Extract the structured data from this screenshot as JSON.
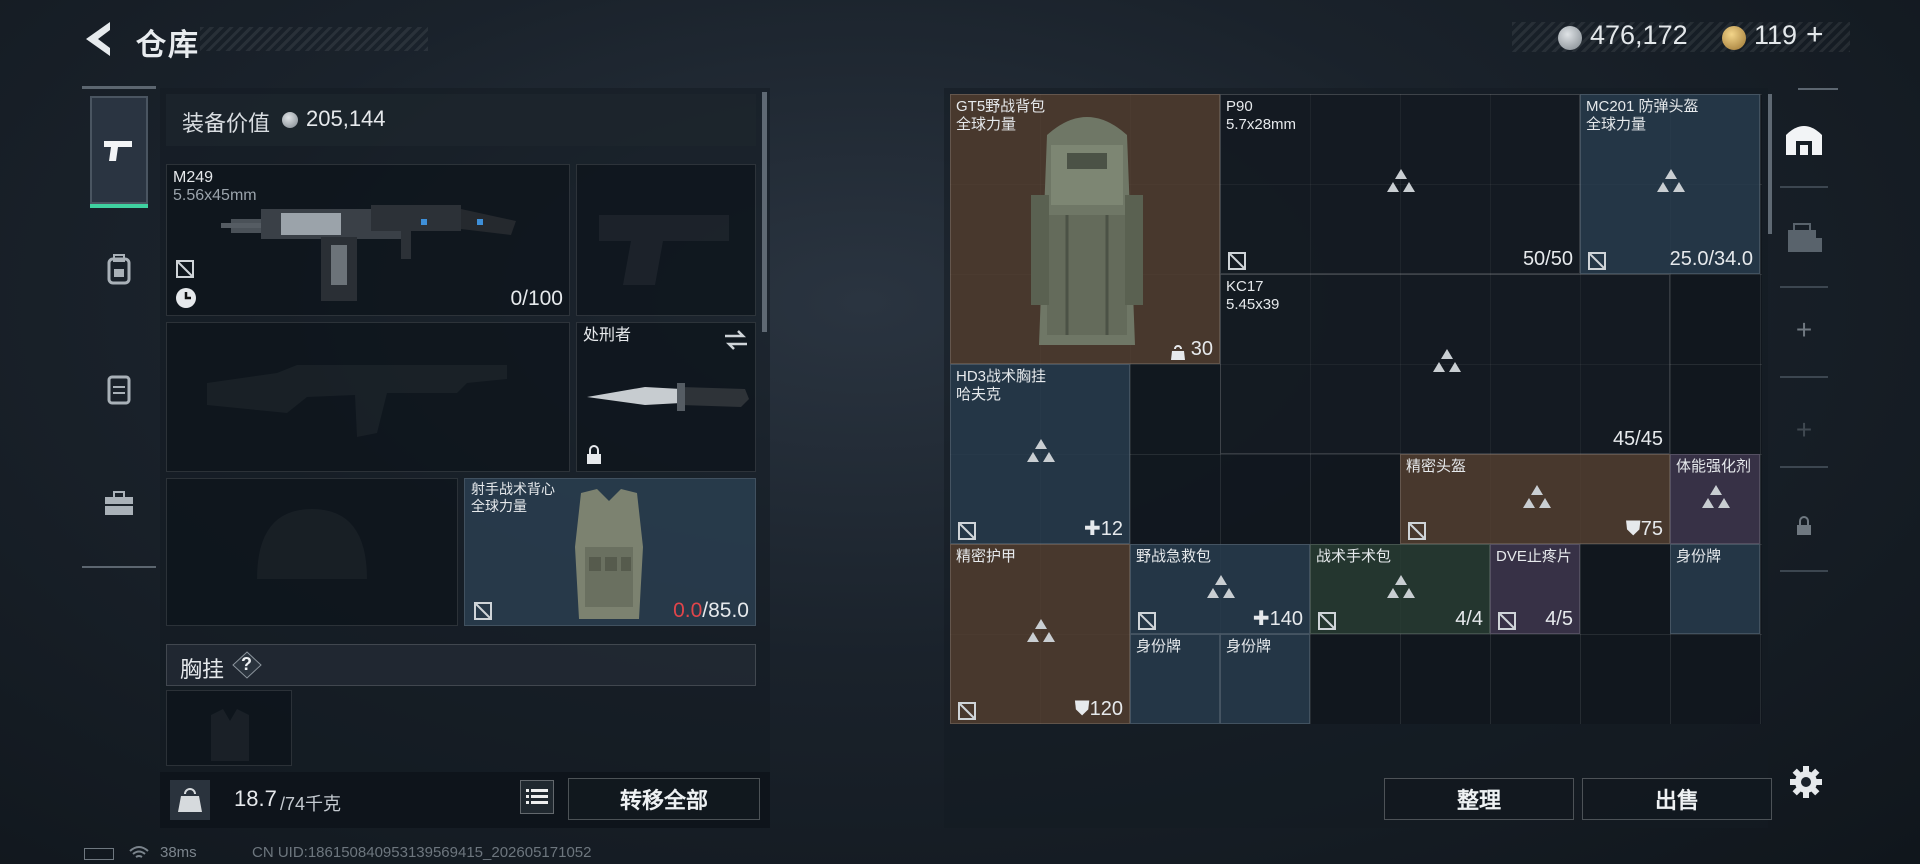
{
  "header": {
    "title": "仓库",
    "currency_silver": "476,172",
    "currency_gold": "119",
    "plus_symbol": "+"
  },
  "equipment": {
    "value_label": "装备价值",
    "value": "205,144",
    "primary": {
      "name": "M249",
      "ammo": "5.56x45mm",
      "count": "0/100"
    },
    "knife": {
      "name": "处刑者"
    },
    "vest": {
      "name": "射手战术背心",
      "faction": "全球力量",
      "durability_current": "0.0",
      "durability_max": "/85.0"
    },
    "chest_rig": {
      "label": "胸挂",
      "help": "?"
    }
  },
  "footer_left": {
    "weight": "18.7",
    "weight_max": "/74千克",
    "transfer_all": "转移全部"
  },
  "status": {
    "ping": "38ms",
    "uid": "CN UID:186150840953139569415_202605171052"
  },
  "storage": {
    "items": [
      {
        "name": "GT5野战背包",
        "sub": "全球力量",
        "value": "30"
      },
      {
        "name": "P90",
        "sub": "5.7x28mm",
        "value": "50/50"
      },
      {
        "name": "MC201 防弹头盔",
        "sub": "全球力量",
        "value": "25.0/34.0"
      },
      {
        "name": "KC17",
        "sub": "5.45x39",
        "value": "45/45"
      },
      {
        "name": "HD3战术胸挂",
        "sub": "哈夫克",
        "value": "12"
      },
      {
        "name": "精密头盔",
        "sub": "",
        "value": "75"
      },
      {
        "name": "体能强化剂",
        "sub": "",
        "value": ""
      },
      {
        "name": "精密护甲",
        "sub": "",
        "value": "120"
      },
      {
        "name": "野战急救包",
        "sub": "",
        "value": "140"
      },
      {
        "name": "战术手术包",
        "sub": "",
        "value": "4/4"
      },
      {
        "name": "DVE止疼片",
        "sub": "",
        "value": "4/5"
      },
      {
        "name": "身份牌",
        "sub": "",
        "value": ""
      },
      {
        "name": "身份牌",
        "sub": "",
        "value": ""
      },
      {
        "name": "身份牌",
        "sub": "",
        "value": ""
      }
    ],
    "sort_button": "整理",
    "sell_button": "出售"
  },
  "colors": {
    "accent_green": "#3fd1a0",
    "durability_red": "#e0454a",
    "brown_slot": "#523e30",
    "blue_slot": "#283c4e"
  }
}
